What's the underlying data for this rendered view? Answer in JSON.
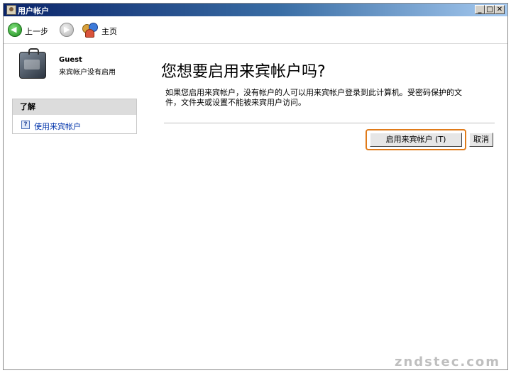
{
  "window": {
    "title": "用户帐户",
    "minimize_glyph": "_",
    "maximize_glyph": "□",
    "close_glyph": "✕"
  },
  "toolbar": {
    "back_label": "上一步",
    "home_label": "主页"
  },
  "user": {
    "name": "Guest",
    "status": "来宾帐户没有启用"
  },
  "learn": {
    "heading": "了解",
    "link": "使用来宾帐户"
  },
  "main": {
    "title": "您想要启用来宾帐户吗?",
    "description_line1": "如果您启用来宾帐户，没有帐户的人可以用来宾帐户登录到此计算机。受密码保护的文",
    "description_line2": "件，文件夹或设置不能被来宾用户访问。",
    "enable_button": "启用来宾帐户 (T)",
    "cancel_button": "取消"
  },
  "watermark": "zndstec.com",
  "colors": {
    "titlebar_start": "#0a246a",
    "titlebar_end": "#a6caf0",
    "focus_ring": "#e07b1a",
    "link": "#0033aa"
  },
  "icons": {
    "back": "back-arrow-icon",
    "forward": "forward-arrow-icon",
    "home": "users-home-icon",
    "user": "briefcase-user-icon",
    "help": "help-icon"
  }
}
